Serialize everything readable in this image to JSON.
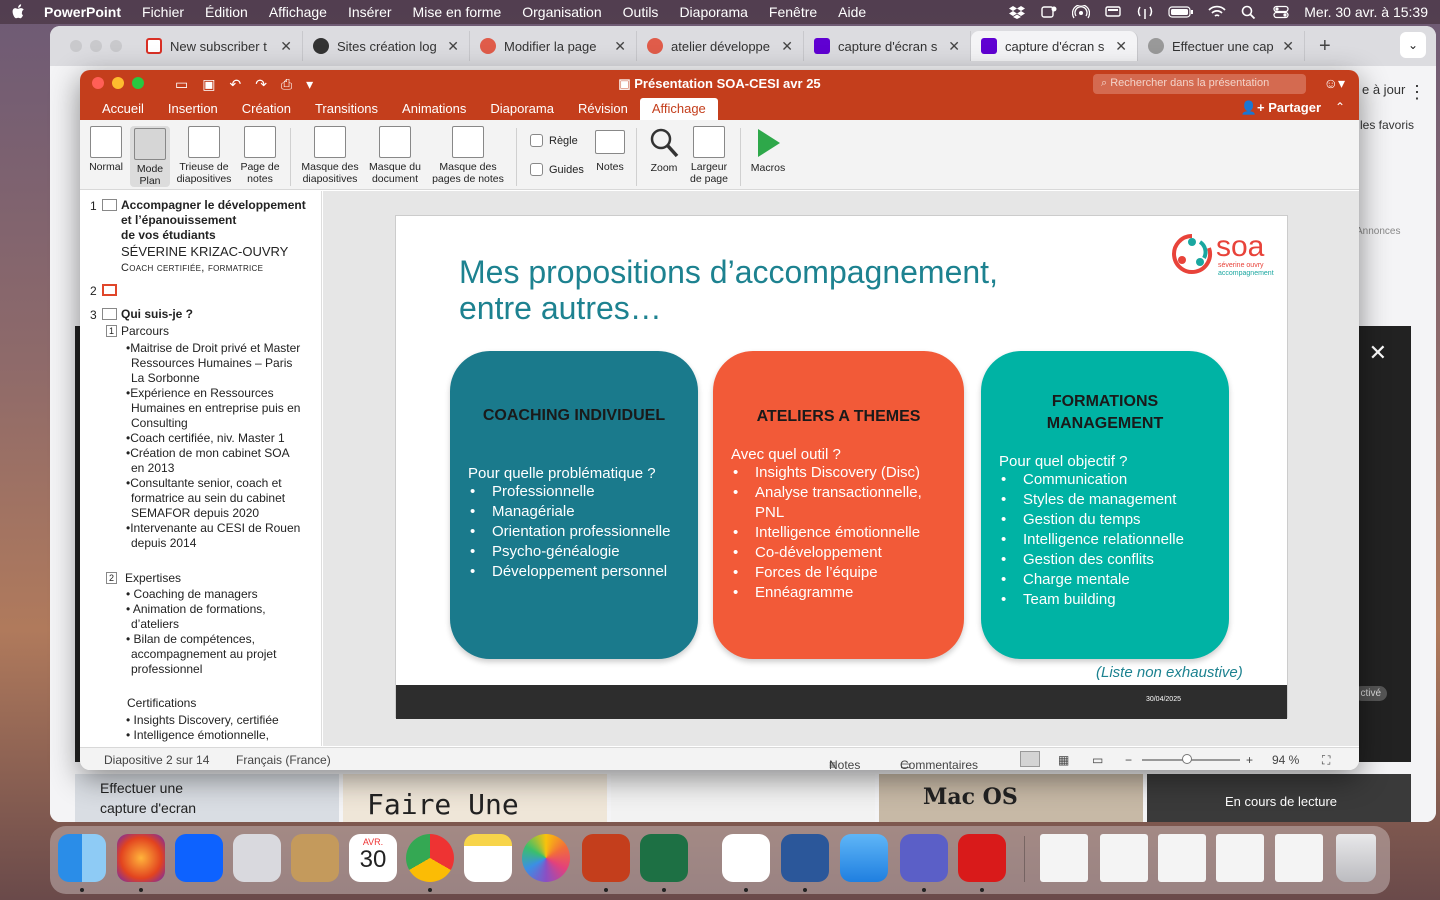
{
  "menubar": {
    "items": [
      "PowerPoint",
      "Fichier",
      "Édition",
      "Affichage",
      "Insérer",
      "Mise en forme",
      "Organisation",
      "Outils",
      "Diaporama",
      "Fenêtre",
      "Aide"
    ],
    "datetime": "Mer. 30 avr. à  15:39"
  },
  "browser": {
    "tabs": [
      {
        "title": "New subscriber t",
        "color": "#d93025"
      },
      {
        "title": "Sites création log",
        "color": "#333333"
      },
      {
        "title": "Modifier la page",
        "color": "#e05c4a"
      },
      {
        "title": "atelier développe",
        "color": "#e05c4a"
      },
      {
        "title": "capture d'écran s",
        "color": "#6001d2"
      },
      {
        "title": "capture d'écran s",
        "color": "#6001d2"
      },
      {
        "title": "Effectuer une cap",
        "color": "#888888"
      }
    ],
    "right_update": "e à jour",
    "right_favs": "les favoris",
    "right_ads": "Annonces",
    "right_active": "ctivé",
    "thumb_1": "Effectuer une capture d'ecran",
    "thumb_2": "Faire Une Capture",
    "thumb_3": "Mac  OS",
    "thumb_4": "En cours de lecture"
  },
  "ppt": {
    "title": "Présentation SOA-CESI avr 25",
    "search_placeholder": "Rechercher dans la présentation",
    "tabs": [
      "Accueil",
      "Insertion",
      "Création",
      "Transitions",
      "Animations",
      "Diaporama",
      "Révision",
      "Affichage"
    ],
    "share": "Partager",
    "ribbon": {
      "normal": "Normal",
      "mode_plan": "Mode Plan",
      "trieuse": "Trieuse de diapositives",
      "page_notes": "Page de notes",
      "masque_diapos": "Masque des diapositives",
      "masque_doc": "Masque du document",
      "masque_notes": "Masque des pages de notes",
      "regle": "Règle",
      "guides": "Guides",
      "notes": "Notes",
      "zoom": "Zoom",
      "largeur": "Largeur de page",
      "macros": "Macros"
    },
    "outline": {
      "s1_num": "1",
      "s1_title1": "Accompagner le développement",
      "s1_title2": "et l’épanouissement",
      "s1_title3": "de vos étudiants",
      "s1_name": "SÉVERINE KRIZAC-OUVRY",
      "s1_role": "Coach certifiée, formatrice",
      "s2_num": "2",
      "s3_num": "3",
      "s3_title": "Qui suis-je ?",
      "p1_num": "1",
      "p1": "Parcours",
      "b1a": "•Maitrise de Droit privé et Master",
      "b1b": "Ressources Humaines – Paris",
      "b1c": "La Sorbonne",
      "b2a": "•Expérience en Ressources",
      "b2b": "Humaines en entreprise puis en",
      "b2c": "Consulting",
      "b3": "•Coach certifiée, niv. Master 1",
      "b4a": "•Création de mon cabinet SOA",
      "b4b": "en 2013",
      "b5a": "•Consultante senior, coach et",
      "b5b": "formatrice au sein du cabinet",
      "b5c": "SEMAFOR depuis 2020",
      "b6a": "•Intervenante au CESI de Rouen",
      "b6b": "depuis 2014",
      "p2_num": "2",
      "p2": "Expertises",
      "e1": "• Coaching de managers",
      "e2a": "• Animation de formations,",
      "e2b": "d’ateliers",
      "e3a": "• Bilan de compétences,",
      "e3b": "accompagnement au projet",
      "e3c": "professionnel",
      "cert": "Certifications",
      "c1": "• Insights Discovery, certifiée",
      "c2": "• Intelligence émotionnelle,"
    },
    "slide": {
      "title1": "Mes propositions d’accompagnement,",
      "title2": "entre autres…",
      "logo_name": "soa",
      "logo_sub1": "séverine ouvry",
      "logo_sub2": "accompagnement",
      "cards": [
        {
          "title": "COACHING INDIVIDUEL",
          "question": "Pour quelle problématique ?",
          "items": [
            "Professionnelle",
            "Managériale",
            "Orientation professionnelle",
            "Psycho-généalogie",
            "Développement personnel"
          ]
        },
        {
          "title": "ATELIERS A THEMES",
          "question": "Avec quel outil ?",
          "items": [
            "Insights Discovery (Disc)",
            "Analyse transactionnelle, PNL",
            "Intelligence émotionnelle",
            "Co-développement",
            "Forces de l’équipe",
            "Ennéagramme"
          ]
        },
        {
          "title": "FORMATIONS MANAGEMENT",
          "question": "Pour quel objectif ?",
          "items": [
            "Communication",
            "Styles de management",
            "Gestion du temps",
            "Intelligence relationnelle",
            "Gestion des conflits",
            "Charge mentale",
            "Team building"
          ]
        }
      ],
      "note": "(Liste non exhaustive)",
      "date": "30/04/2025"
    },
    "status": {
      "slide": "Diapositive 2 sur 14",
      "lang": "Français (France)",
      "notes": "Notes",
      "comments": "Commentaires",
      "zoom": "94 %"
    }
  },
  "dock": {
    "calendar_month": "AVR.",
    "calendar_day": "30"
  },
  "colors": {
    "ppt_red": "#c43e1c",
    "card1": "#1a7a8c",
    "card2": "#f25a38",
    "card3": "#00b3a4",
    "title_teal": "#1d8290"
  }
}
